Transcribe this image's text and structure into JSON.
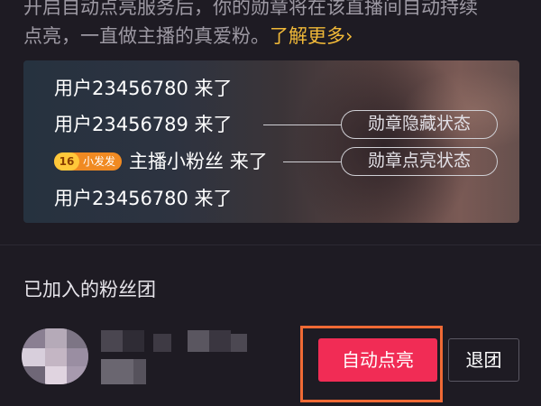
{
  "intro": {
    "line1": "开启自动点亮服务后，你的勋章将在该直播间自动持续",
    "line2": "点亮，一直做主播的真爱粉。",
    "more_link": "了解更多",
    "more_icon": "chevron-right-icon"
  },
  "demo": {
    "rows": [
      "用户23456780 来了",
      "用户23456789 来了",
      "主播小粉丝 来了",
      "用户23456780 来了"
    ],
    "badge_level": "16",
    "badge_name": "小发发",
    "labels": {
      "hidden": "勋章隐藏状态",
      "lit": "勋章点亮状态"
    }
  },
  "joined": {
    "title": "已加入的粉丝团",
    "auto_light_button": "自动点亮",
    "quit_button": "退团"
  },
  "colors": {
    "accent": "#f12c55",
    "link": "#f1b938",
    "highlight": "#f06a35"
  }
}
